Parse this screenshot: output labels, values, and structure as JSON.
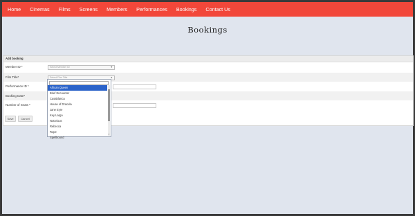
{
  "nav": {
    "items": [
      "Home",
      "Cinemas",
      "Films",
      "Screens",
      "Members",
      "Performances",
      "Bookings",
      "Contact Us"
    ]
  },
  "page": {
    "title": "Bookings"
  },
  "form": {
    "header": "Add booking",
    "member_label": "Member ID *",
    "member_placeholder": "Select Member ID",
    "film_label": "Film Title*",
    "film_placeholder": "Select Film Title",
    "performance_label": "Performance ID *",
    "date_label": "Booking Date*",
    "seats_label": "Number of Seats *",
    "save_label": "Save",
    "cancel_label": "Cancel"
  },
  "dropdown": {
    "options": [
      "African Queen",
      "Brief Encounter",
      "Casablanca",
      "House of Dracula",
      "Jane Eyre",
      "Key Largo",
      "Notorious",
      "Rebecca",
      "Rope",
      "Spellbound"
    ],
    "selected": "African Queen"
  },
  "colors": {
    "nav_bg": "#f2473a",
    "page_bg": "#e0e5ee",
    "selected_option": "#2b63c9"
  }
}
